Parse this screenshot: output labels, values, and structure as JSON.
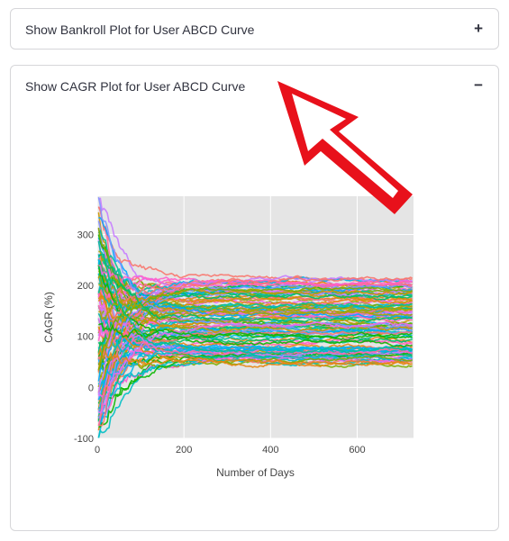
{
  "expanders": [
    {
      "title": "Show Bankroll Plot for User ABCD Curve",
      "toggle": "+",
      "expanded": false
    },
    {
      "title": "Show CAGR Plot for User ABCD Curve",
      "toggle": "−",
      "expanded": true
    }
  ],
  "annotation": {
    "icon": "red-arrow-icon",
    "color": "#e8111b",
    "points_to": "Show CAGR Plot for User ABCD Curve"
  },
  "chart_data": {
    "type": "line",
    "xlabel": "Number of Days",
    "ylabel": "CAGR (%)",
    "xlim": [
      0,
      730
    ],
    "ylim": [
      -100,
      375
    ],
    "xticks": [
      0,
      200,
      400,
      600
    ],
    "yticks": [
      -100,
      0,
      100,
      200,
      300
    ],
    "grid": true,
    "background": "#e5e5e5",
    "series_count": 120,
    "series_note": "many simulated CAGR paths, converging from wide spread near day 0 toward roughly 50 to 210 percent by day 730",
    "palette": [
      "#f8766d",
      "#e68613",
      "#cd9600",
      "#aba300",
      "#7cae00",
      "#0cb702",
      "#00be67",
      "#00c19a",
      "#00bfc4",
      "#00b8e7",
      "#00a9ff",
      "#8494ff",
      "#c77cff",
      "#ed68ed",
      "#ff61cc",
      "#ff68a1"
    ],
    "end_range": [
      45,
      215
    ]
  }
}
